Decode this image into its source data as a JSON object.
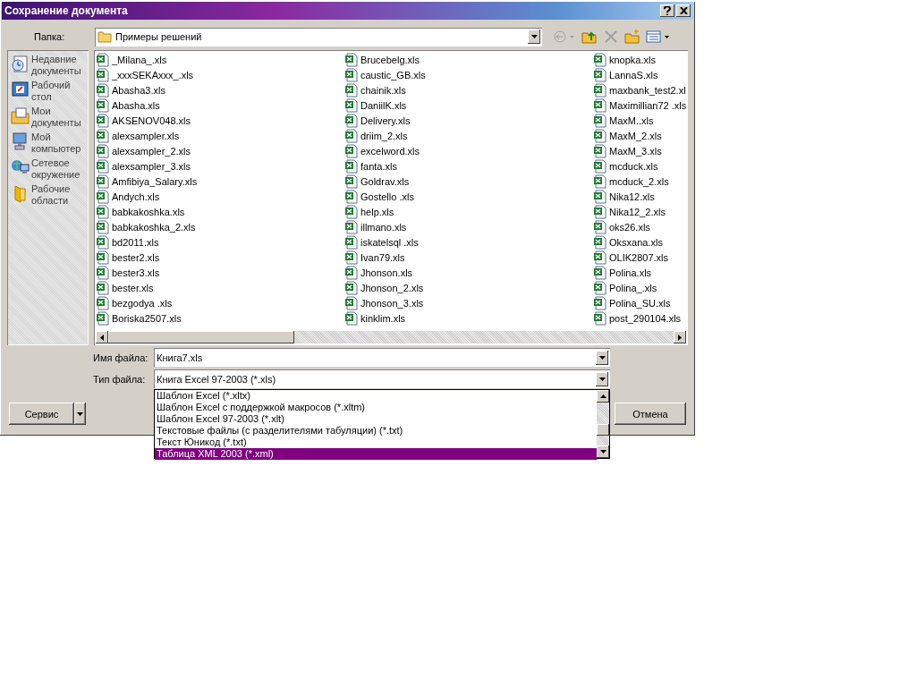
{
  "window": {
    "title": "Сохранение документа"
  },
  "folder": {
    "label": "Папка:",
    "value": "Примеры решений"
  },
  "places": [
    {
      "kind": "recent",
      "label": "Недавние документы"
    },
    {
      "kind": "desktop",
      "label": "Рабочий стол"
    },
    {
      "kind": "documents",
      "label": "Мои документы"
    },
    {
      "kind": "computer",
      "label": "Мой компьютер"
    },
    {
      "kind": "network",
      "label": "Сетевое окружение"
    },
    {
      "kind": "workspaces",
      "label": "Рабочие области"
    }
  ],
  "files": {
    "columns": [
      [
        "_Milana_.xls",
        "_xxxSEKAxxx_.xls",
        "Abasha3.xls",
        "Abasha.xls",
        "AKSENOV048.xls",
        "alexsampler.xls",
        "alexsampler_2.xls",
        "alexsampler_3.xls",
        "Amfibiya_Salary.xls",
        "Andych.xls",
        "babkakoshka.xls",
        "babkakoshka_2.xls",
        "bd2011.xls",
        "bester2.xls",
        "bester3.xls",
        "bester.xls",
        "bezgodya .xls",
        "Boriska2507.xls"
      ],
      [
        "Brucebelg.xls",
        "caustic_GB.xls",
        "chainik.xls",
        "DaniilK.xls",
        "Delivery.xls",
        "driim_2.xls",
        "excelword.xls",
        "fanta.xls",
        "Goldrav.xls",
        "Gostello .xls",
        "help.xls",
        "illmano.xls",
        "iskatelsql .xls",
        "Ivan79.xls",
        "Jhonson.xls",
        "Jhonson_2.xls",
        "Jhonson_3.xls",
        "kinklim.xls"
      ],
      [
        "knopka.xls",
        "LannaS.xls",
        "maxbank_test2.xl",
        "Maximillian72 .xls",
        "MaxM..xls",
        "MaxM_2.xls",
        "MaxM_3.xls",
        "mcduck.xls",
        "mcduck_2.xls",
        "Nika12.xls",
        "Nika12_2.xls",
        "oks26.xls",
        "Oksxana.xls",
        "OLIK2807.xls",
        "Polina.xls",
        "Polina_.xls",
        "Polina_SU.xls",
        "post_290104.xls"
      ]
    ]
  },
  "file_name": {
    "label": "Имя файла:",
    "value": "Книга7.xls"
  },
  "file_type": {
    "label": "Тип файла:",
    "value": "Книга Excel 97-2003 (*.xls)",
    "options": [
      {
        "label": "Шаблон Excel (*.xltx)",
        "selected": false
      },
      {
        "label": "Шаблон Excel с поддержкой макросов (*.xltm)",
        "selected": false
      },
      {
        "label": "Шаблон Excel 97-2003 (*.xlt)",
        "selected": false
      },
      {
        "label": "Текстовые файлы (с разделителями табуляции) (*.txt)",
        "selected": false
      },
      {
        "label": "Текст Юникод (*.txt)",
        "selected": false
      },
      {
        "label": "Таблица XML 2003 (*.xml)",
        "selected": true
      }
    ]
  },
  "buttons": {
    "tools": "Сервис",
    "cancel": "Отмена"
  }
}
